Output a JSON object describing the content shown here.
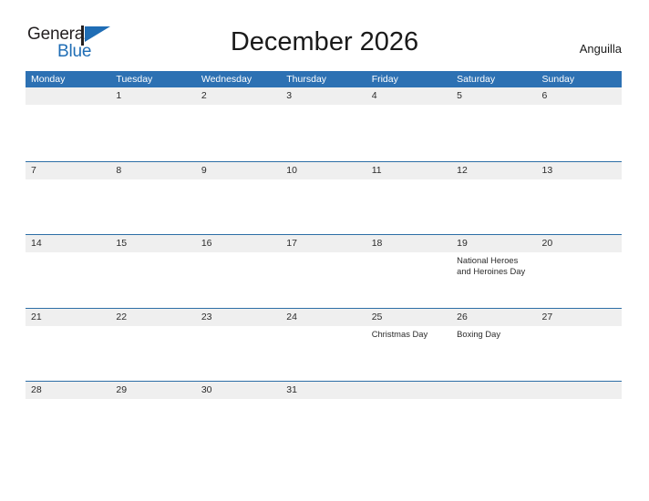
{
  "brand": {
    "name_part1": "General",
    "name_part2": "Blue",
    "flag_icon": "flag-triangle-icon",
    "accent_color": "#1f6db5"
  },
  "header": {
    "title": "December 2026",
    "region": "Anguilla"
  },
  "theme": {
    "header_blue": "#2d71b3",
    "row_divider_blue": "#2d6ea6",
    "band_gray": "#efefef",
    "text_dark": "#2b2b2b"
  },
  "calendar": {
    "month": "December",
    "year": "2026",
    "weekday_headers": [
      "Monday",
      "Tuesday",
      "Wednesday",
      "Thursday",
      "Friday",
      "Saturday",
      "Sunday"
    ],
    "weeks": [
      [
        {
          "day": "",
          "events": []
        },
        {
          "day": "1",
          "events": []
        },
        {
          "day": "2",
          "events": []
        },
        {
          "day": "3",
          "events": []
        },
        {
          "day": "4",
          "events": []
        },
        {
          "day": "5",
          "events": []
        },
        {
          "day": "6",
          "events": []
        }
      ],
      [
        {
          "day": "7",
          "events": []
        },
        {
          "day": "8",
          "events": []
        },
        {
          "day": "9",
          "events": []
        },
        {
          "day": "10",
          "events": []
        },
        {
          "day": "11",
          "events": []
        },
        {
          "day": "12",
          "events": []
        },
        {
          "day": "13",
          "events": []
        }
      ],
      [
        {
          "day": "14",
          "events": []
        },
        {
          "day": "15",
          "events": []
        },
        {
          "day": "16",
          "events": []
        },
        {
          "day": "17",
          "events": []
        },
        {
          "day": "18",
          "events": []
        },
        {
          "day": "19",
          "events": [
            "National Heroes and Heroines Day"
          ]
        },
        {
          "day": "20",
          "events": []
        }
      ],
      [
        {
          "day": "21",
          "events": []
        },
        {
          "day": "22",
          "events": []
        },
        {
          "day": "23",
          "events": []
        },
        {
          "day": "24",
          "events": []
        },
        {
          "day": "25",
          "events": [
            "Christmas Day"
          ]
        },
        {
          "day": "26",
          "events": [
            "Boxing Day"
          ]
        },
        {
          "day": "27",
          "events": []
        }
      ],
      [
        {
          "day": "28",
          "events": []
        },
        {
          "day": "29",
          "events": []
        },
        {
          "day": "30",
          "events": []
        },
        {
          "day": "31",
          "events": []
        },
        {
          "day": "",
          "events": []
        },
        {
          "day": "",
          "events": []
        },
        {
          "day": "",
          "events": []
        }
      ]
    ]
  }
}
